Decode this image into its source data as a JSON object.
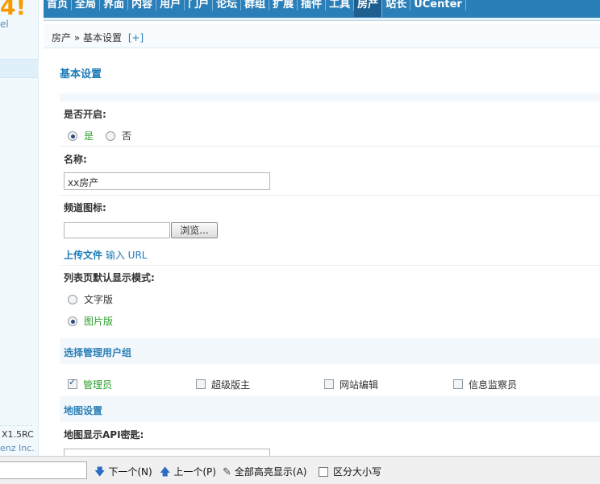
{
  "logo": {
    "text": "4!",
    "sub": "el"
  },
  "left": {
    "version": "X1.5RC",
    "copyright": "enz Inc."
  },
  "nav": {
    "items": [
      "首页",
      "全局",
      "界面",
      "内容",
      "用户",
      "门户",
      "论坛",
      "群组",
      "扩展",
      "插件",
      "工具",
      "房产",
      "站长",
      "UCenter"
    ],
    "active_index": 11
  },
  "breadcrumb": {
    "path": "房产 » 基本设置",
    "plus": "[+]"
  },
  "main": {
    "title": "基本设置",
    "enable": {
      "label": "是否开启:",
      "yes": "是",
      "no": "否",
      "selected": "yes"
    },
    "name": {
      "label": "名称:",
      "value": "xx房产"
    },
    "icon": {
      "label": "频道图标:",
      "browse": "浏览...",
      "upload": "上传文件",
      "input_url": "输入 URL"
    },
    "list_mode": {
      "label": "列表页默认显示模式:",
      "text": "文字版",
      "image": "图片版",
      "selected": "image"
    },
    "groups": {
      "title": "选择管理用户组",
      "admin": "管理员",
      "super_mod": "超级版主",
      "editor": "网站编辑",
      "inspector": "信息监察员",
      "checked": "admin"
    },
    "map": {
      "title": "地图设置",
      "api_label": "地图显示API密匙:"
    }
  },
  "findbar": {
    "next": "下一个(N)",
    "prev": "上一个(P)",
    "highlight": "全部高亮显示(A)",
    "match_case": "区分大小写"
  },
  "colors": {
    "nav_bg": "#2b7fb8",
    "nav_active": "#1e5f8f",
    "title": "#1a7ab8",
    "green": "#2ca02c"
  }
}
